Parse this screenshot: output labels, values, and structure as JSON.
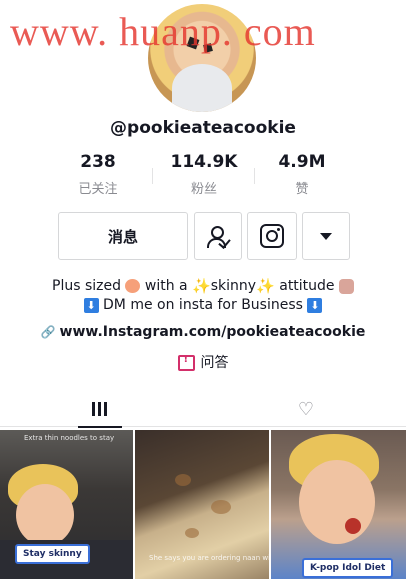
{
  "watermark": "www. huanp. com",
  "profile": {
    "username": "@pookieateacookie"
  },
  "stats": [
    {
      "value": "238",
      "label": "已关注"
    },
    {
      "value": "114.9K",
      "label": "粉丝"
    },
    {
      "value": "4.9M",
      "label": "赞"
    }
  ],
  "actions": {
    "message_label": "消息",
    "follow_icon": "person-check-icon",
    "instagram_icon": "instagram-icon",
    "more_icon": "caret-down-icon"
  },
  "bio": {
    "line1_a": "Plus sized",
    "line1_b": "with a",
    "line1_c": "skinny",
    "line1_d": "attitude",
    "line2": "DM me on insta for Business"
  },
  "link": "www.Instagram.com/pookieateacookie",
  "qa_label": "问答",
  "tabs": {
    "grid_icon": "grid-icon",
    "liked_icon": "heart-hidden-icon"
  },
  "videos": [
    {
      "overlay_top": "Extra thin noodles to stay",
      "tag": "Stay skinny"
    },
    {
      "overlay_bottom": "She says you are ordering naan with"
    },
    {
      "tag": "K-pop Idol Diet"
    }
  ]
}
